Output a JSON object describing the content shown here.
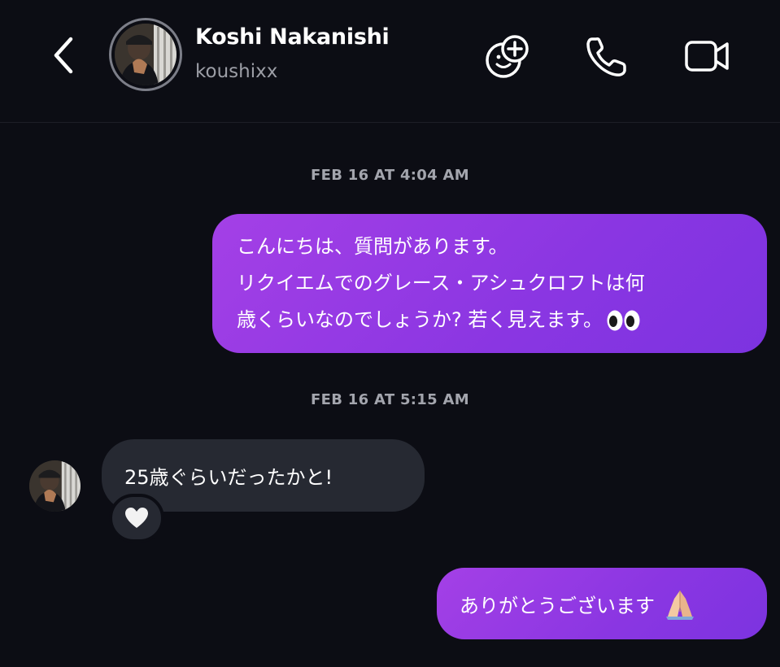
{
  "header": {
    "display_name": "Koshi Nakanishi",
    "username": "koushixx",
    "icons": [
      "chevron-left-icon",
      "sticker-add-icon",
      "phone-icon",
      "video-camera-icon"
    ]
  },
  "thread": {
    "timestamp_1": "FEB 16 AT 4:04 AM",
    "message_1": {
      "line_1": "こんにちは、質問があります。",
      "line_2": "リクイエムでのグレース・アシュクロフトは何",
      "line_3": "歳くらいなのでしょうか? 若く見えます。",
      "emoji": "eyes-emoji"
    },
    "timestamp_2": "FEB 16 AT 5:15 AM",
    "message_2": {
      "text": "25歳ぐらいだったかと!",
      "reaction": "white-heart"
    },
    "message_3": {
      "text": "ありがとうございます",
      "emoji": "folded-hands-emoji"
    }
  },
  "colors": {
    "background": "#0c0d14",
    "outgoing_bubble": "#8a36e2",
    "incoming_bubble": "#262932",
    "timestamp": "#a3a5ad",
    "username": "#9c9ea6"
  }
}
